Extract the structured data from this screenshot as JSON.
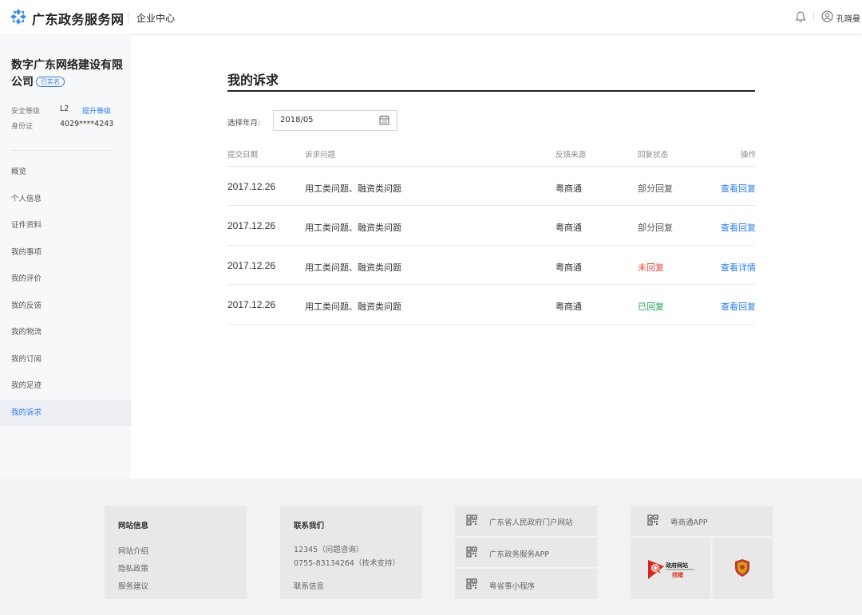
{
  "header": {
    "site_name": "广东政务服务网",
    "center_name": "企业中心",
    "user_name": "孔晓曼"
  },
  "sidebar": {
    "company_name": "数字广东网络建设有限公司",
    "verified_label": "已实名",
    "security_level_label": "安全等级",
    "security_level_value": "L2",
    "upgrade_label": "提升等级",
    "id_label": "身份证",
    "id_value": "4029****4243",
    "items": [
      {
        "label": "概览"
      },
      {
        "label": "个人信息"
      },
      {
        "label": "证件资料"
      },
      {
        "label": "我的事项"
      },
      {
        "label": "我的评价"
      },
      {
        "label": "我的反馈"
      },
      {
        "label": "我的物流"
      },
      {
        "label": "我的订阅"
      },
      {
        "label": "我的足迹"
      },
      {
        "label": "我的诉求"
      }
    ],
    "active_item": "我的诉求"
  },
  "main": {
    "title": "我的诉求",
    "select_label": "选择年月:",
    "selected_month": "2018/05",
    "columns": [
      "提交日期",
      "诉求问题",
      "反馈来源",
      "回复状态",
      "操作"
    ],
    "rows": [
      {
        "date": "2017.12.26",
        "issue": "用工类问题、融资类问题",
        "source": "粤商通",
        "status": "部分回复",
        "status_type": "partial",
        "action": "查看回复"
      },
      {
        "date": "2017.12.26",
        "issue": "用工类问题、融资类问题",
        "source": "粤商通",
        "status": "部分回复",
        "status_type": "partial",
        "action": "查看回复"
      },
      {
        "date": "2017.12.26",
        "issue": "用工类问题、融资类问题",
        "source": "粤商通",
        "status": "未回复",
        "status_type": "none",
        "action": "查看详情"
      },
      {
        "date": "2017.12.26",
        "issue": "用工类问题、融资类问题",
        "source": "粤商通",
        "status": "已回复",
        "status_type": "done",
        "action": "查看回复"
      }
    ]
  },
  "footer": {
    "site_info": {
      "title": "网站信息",
      "links": [
        "网站介绍",
        "隐私政策",
        "服务建议"
      ]
    },
    "contact": {
      "title": "联系我们",
      "lines": [
        "12345（问题咨询）",
        "0755-83134264（技术支持）"
      ],
      "link": "联系信息"
    },
    "qr_links": [
      "广东省人民政府门户网站",
      "广东政务服务APP",
      "粤省事小程序"
    ],
    "app": "粤商通APP",
    "gov_badge": [
      "政府网站",
      "找错"
    ]
  },
  "colors": {
    "accent": "#2b7de9",
    "status_none": "#e5483d",
    "status_done": "#23a45a",
    "logo": "#3a8ee6"
  }
}
